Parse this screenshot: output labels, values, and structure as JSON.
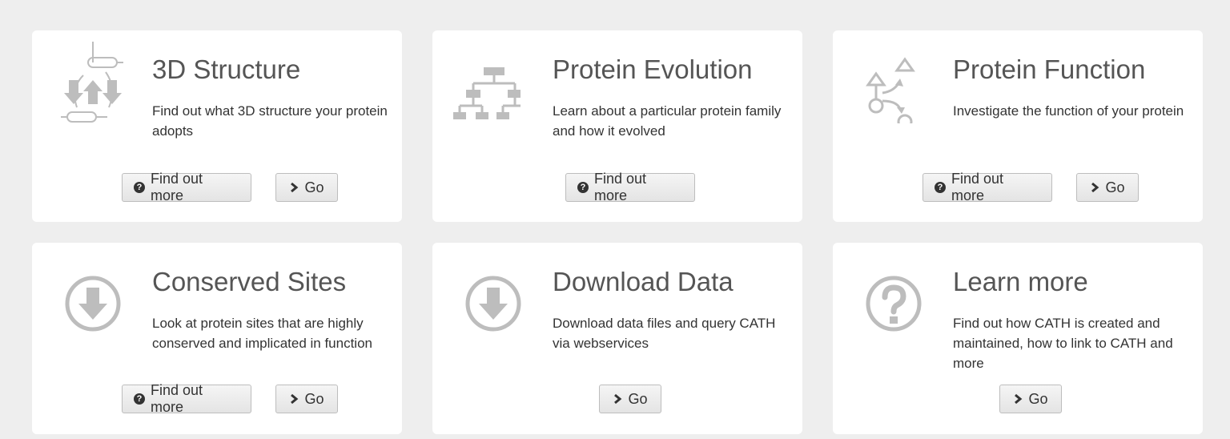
{
  "cards": [
    {
      "title": "3D Structure",
      "desc": "Find out what 3D structure your protein adopts",
      "icon": "structure-icon"
    },
    {
      "title": "Protein Evolution",
      "desc": "Learn about a particular protein family and how it evolved",
      "icon": "tree-icon"
    },
    {
      "title": "Protein Function",
      "desc": "Investigate the function of your protein",
      "icon": "function-icon"
    },
    {
      "title": "Conserved Sites",
      "desc": "Look at protein sites that are highly conserved and implicated in function",
      "icon": "download-circle-icon"
    },
    {
      "title": "Download Data",
      "desc": "Download data files and query CATH via webservices",
      "icon": "download-circle-icon"
    },
    {
      "title": "Learn more",
      "desc": "Find out how CATH is created and maintained, how to link to CATH and more",
      "icon": "question-circle-icon"
    }
  ],
  "buttons": {
    "find_out_more": "Find out more",
    "go": "Go"
  },
  "colors": {
    "background": "#eeeeee",
    "card": "#ffffff",
    "icon_gray": "#bdbdbd",
    "title": "#555555"
  }
}
